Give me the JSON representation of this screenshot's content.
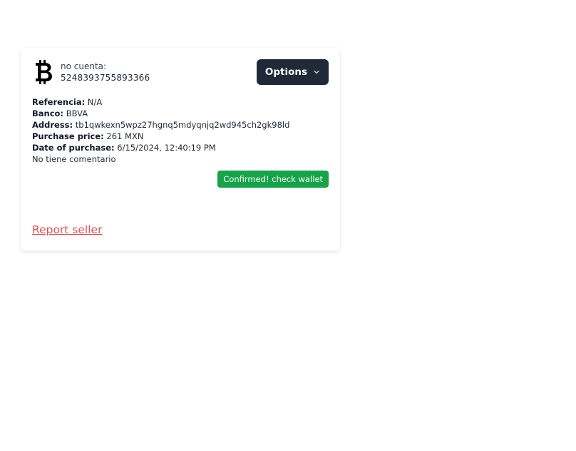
{
  "card": {
    "icon": "bitcoin-icon",
    "account_label": "no cuenta:",
    "account_number": "5248393755893366",
    "options_label": "Options",
    "options_icon": "chevron-down-icon",
    "details": {
      "reference_label": "Referencia:",
      "reference_value": "N/A",
      "bank_label": "Banco:",
      "bank_value": "BBVA",
      "address_label": "Address:",
      "address_value": "tb1qwkexn5wpz27hgnq5mdyqnjq2wd945ch2gk98ld",
      "price_label": "Purchase price:",
      "price_value": "261 MXN",
      "date_label": "Date of purchase:",
      "date_value": "6/15/2024, 12:40:19 PM",
      "comment": "No tiene comentario"
    },
    "status": "Confirmed! check wallet",
    "report_link": "Report seller"
  },
  "colors": {
    "button_bg": "#1f2937",
    "status_green": "#16a34a",
    "report_red": "#e05252"
  }
}
